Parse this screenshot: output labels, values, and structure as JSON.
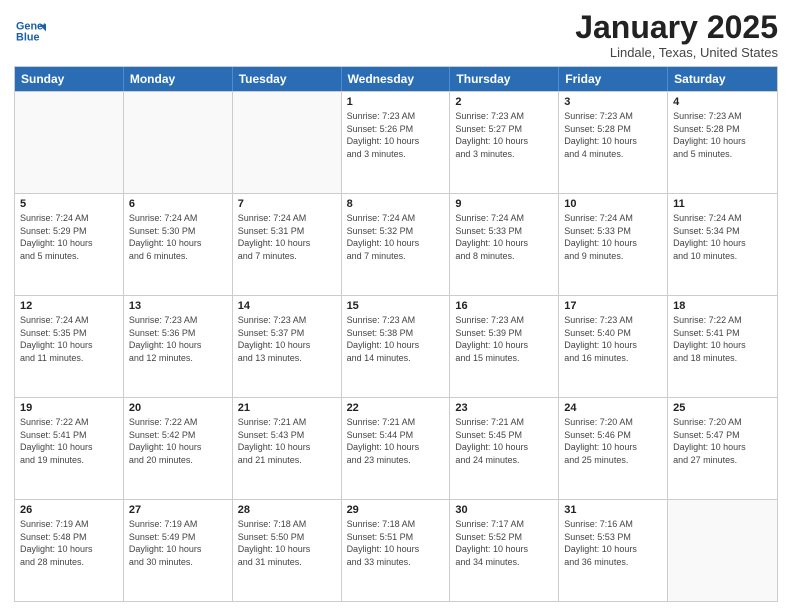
{
  "logo": {
    "line1": "General",
    "line2": "Blue"
  },
  "title": "January 2025",
  "subtitle": "Lindale, Texas, United States",
  "headers": [
    "Sunday",
    "Monday",
    "Tuesday",
    "Wednesday",
    "Thursday",
    "Friday",
    "Saturday"
  ],
  "rows": [
    [
      {
        "day": "",
        "info": ""
      },
      {
        "day": "",
        "info": ""
      },
      {
        "day": "",
        "info": ""
      },
      {
        "day": "1",
        "info": "Sunrise: 7:23 AM\nSunset: 5:26 PM\nDaylight: 10 hours\nand 3 minutes."
      },
      {
        "day": "2",
        "info": "Sunrise: 7:23 AM\nSunset: 5:27 PM\nDaylight: 10 hours\nand 3 minutes."
      },
      {
        "day": "3",
        "info": "Sunrise: 7:23 AM\nSunset: 5:28 PM\nDaylight: 10 hours\nand 4 minutes."
      },
      {
        "day": "4",
        "info": "Sunrise: 7:23 AM\nSunset: 5:28 PM\nDaylight: 10 hours\nand 5 minutes."
      }
    ],
    [
      {
        "day": "5",
        "info": "Sunrise: 7:24 AM\nSunset: 5:29 PM\nDaylight: 10 hours\nand 5 minutes."
      },
      {
        "day": "6",
        "info": "Sunrise: 7:24 AM\nSunset: 5:30 PM\nDaylight: 10 hours\nand 6 minutes."
      },
      {
        "day": "7",
        "info": "Sunrise: 7:24 AM\nSunset: 5:31 PM\nDaylight: 10 hours\nand 7 minutes."
      },
      {
        "day": "8",
        "info": "Sunrise: 7:24 AM\nSunset: 5:32 PM\nDaylight: 10 hours\nand 7 minutes."
      },
      {
        "day": "9",
        "info": "Sunrise: 7:24 AM\nSunset: 5:33 PM\nDaylight: 10 hours\nand 8 minutes."
      },
      {
        "day": "10",
        "info": "Sunrise: 7:24 AM\nSunset: 5:33 PM\nDaylight: 10 hours\nand 9 minutes."
      },
      {
        "day": "11",
        "info": "Sunrise: 7:24 AM\nSunset: 5:34 PM\nDaylight: 10 hours\nand 10 minutes."
      }
    ],
    [
      {
        "day": "12",
        "info": "Sunrise: 7:24 AM\nSunset: 5:35 PM\nDaylight: 10 hours\nand 11 minutes."
      },
      {
        "day": "13",
        "info": "Sunrise: 7:23 AM\nSunset: 5:36 PM\nDaylight: 10 hours\nand 12 minutes."
      },
      {
        "day": "14",
        "info": "Sunrise: 7:23 AM\nSunset: 5:37 PM\nDaylight: 10 hours\nand 13 minutes."
      },
      {
        "day": "15",
        "info": "Sunrise: 7:23 AM\nSunset: 5:38 PM\nDaylight: 10 hours\nand 14 minutes."
      },
      {
        "day": "16",
        "info": "Sunrise: 7:23 AM\nSunset: 5:39 PM\nDaylight: 10 hours\nand 15 minutes."
      },
      {
        "day": "17",
        "info": "Sunrise: 7:23 AM\nSunset: 5:40 PM\nDaylight: 10 hours\nand 16 minutes."
      },
      {
        "day": "18",
        "info": "Sunrise: 7:22 AM\nSunset: 5:41 PM\nDaylight: 10 hours\nand 18 minutes."
      }
    ],
    [
      {
        "day": "19",
        "info": "Sunrise: 7:22 AM\nSunset: 5:41 PM\nDaylight: 10 hours\nand 19 minutes."
      },
      {
        "day": "20",
        "info": "Sunrise: 7:22 AM\nSunset: 5:42 PM\nDaylight: 10 hours\nand 20 minutes."
      },
      {
        "day": "21",
        "info": "Sunrise: 7:21 AM\nSunset: 5:43 PM\nDaylight: 10 hours\nand 21 minutes."
      },
      {
        "day": "22",
        "info": "Sunrise: 7:21 AM\nSunset: 5:44 PM\nDaylight: 10 hours\nand 23 minutes."
      },
      {
        "day": "23",
        "info": "Sunrise: 7:21 AM\nSunset: 5:45 PM\nDaylight: 10 hours\nand 24 minutes."
      },
      {
        "day": "24",
        "info": "Sunrise: 7:20 AM\nSunset: 5:46 PM\nDaylight: 10 hours\nand 25 minutes."
      },
      {
        "day": "25",
        "info": "Sunrise: 7:20 AM\nSunset: 5:47 PM\nDaylight: 10 hours\nand 27 minutes."
      }
    ],
    [
      {
        "day": "26",
        "info": "Sunrise: 7:19 AM\nSunset: 5:48 PM\nDaylight: 10 hours\nand 28 minutes."
      },
      {
        "day": "27",
        "info": "Sunrise: 7:19 AM\nSunset: 5:49 PM\nDaylight: 10 hours\nand 30 minutes."
      },
      {
        "day": "28",
        "info": "Sunrise: 7:18 AM\nSunset: 5:50 PM\nDaylight: 10 hours\nand 31 minutes."
      },
      {
        "day": "29",
        "info": "Sunrise: 7:18 AM\nSunset: 5:51 PM\nDaylight: 10 hours\nand 33 minutes."
      },
      {
        "day": "30",
        "info": "Sunrise: 7:17 AM\nSunset: 5:52 PM\nDaylight: 10 hours\nand 34 minutes."
      },
      {
        "day": "31",
        "info": "Sunrise: 7:16 AM\nSunset: 5:53 PM\nDaylight: 10 hours\nand 36 minutes."
      },
      {
        "day": "",
        "info": ""
      }
    ]
  ]
}
